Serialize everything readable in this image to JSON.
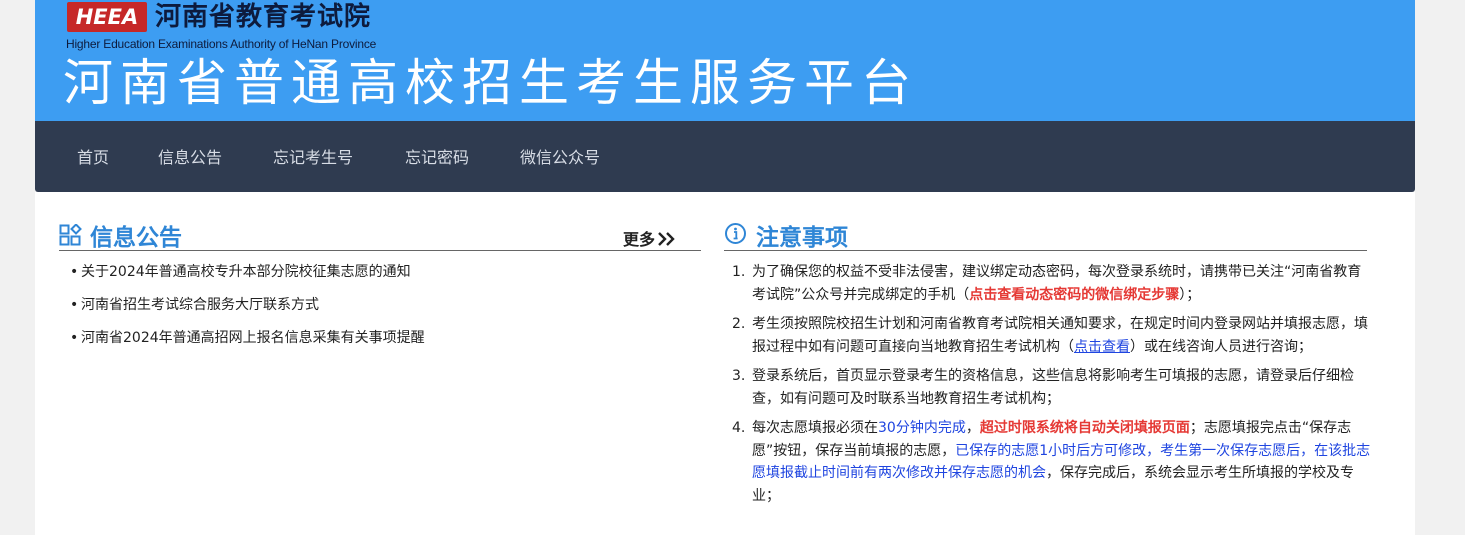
{
  "header": {
    "logo_text": "HEEA",
    "org_name_cn": "河南省教育考试院",
    "org_name_en": "Higher Education Examinations Authority of HeNan Province",
    "platform_title": "河南省普通高校招生考生服务平台"
  },
  "nav": {
    "items": [
      {
        "label": "首页"
      },
      {
        "label": "信息公告"
      },
      {
        "label": "忘记考生号"
      },
      {
        "label": "忘记密码"
      },
      {
        "label": "微信公众号"
      }
    ]
  },
  "news": {
    "title": "信息公告",
    "more_label": "更多",
    "items": [
      {
        "label": "关于2024年普通高校专升本部分院校征集志愿的通知"
      },
      {
        "label": "河南省招生考试综合服务大厅联系方式"
      },
      {
        "label": "河南省2024年普通高招网上报名信息采集有关事项提醒"
      }
    ]
  },
  "notice": {
    "title": "注意事项",
    "items": [
      {
        "num": "1.",
        "segments": [
          {
            "text": "为了确保您的权益不受非法侵害，建议绑定动态密码，每次登录系统时，请携带已关注“河南省教育考试院”公众号并完成绑定的手机（",
            "style": "plain"
          },
          {
            "text": "点击查看动态密码的微信绑定步骤",
            "style": "red"
          },
          {
            "text": "）；",
            "style": "plain"
          }
        ]
      },
      {
        "num": "2.",
        "segments": [
          {
            "text": "考生须按照院校招生计划和河南省教育考试院相关通知要求，在规定时间内登录网站并填报志愿，填报过程中如有问题可直接向当地教育招生考试机构（",
            "style": "plain"
          },
          {
            "text": "点击查看",
            "style": "link"
          },
          {
            "text": "）或在线咨询人员进行咨询；",
            "style": "plain"
          }
        ]
      },
      {
        "num": "3.",
        "segments": [
          {
            "text": "登录系统后，首页显示登录考生的资格信息，这些信息将影响考生可填报的志愿，请登录后仔细检查，如有问题可及时联系当地教育招生考试机构；",
            "style": "plain"
          }
        ]
      },
      {
        "num": "4.",
        "segments": [
          {
            "text": "每次志愿填报必须在",
            "style": "plain"
          },
          {
            "text": "30分钟内完成",
            "style": "blue"
          },
          {
            "text": "，",
            "style": "plain"
          },
          {
            "text": "超过时限系统将自动关闭填报页面",
            "style": "red"
          },
          {
            "text": "；志愿填报完点击“保存志愿”按钮，保存当前填报的志愿，",
            "style": "plain"
          },
          {
            "text": "已保存的志愿1小时后方可修改，考生第一次保存志愿后，在该批志愿填报截止时间前有两次修改并保存志愿的机会",
            "style": "blue"
          },
          {
            "text": "，保存完成后，系统会显示考生所填报的学校及专业；",
            "style": "plain"
          }
        ]
      }
    ]
  }
}
